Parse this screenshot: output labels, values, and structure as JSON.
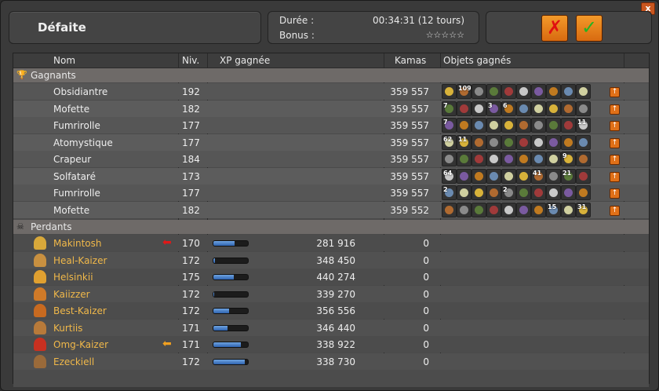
{
  "window": {
    "title": "Défaite",
    "close_label": "x"
  },
  "info": {
    "duration_label": "Durée :",
    "duration_value": "00:34:31 (12 tours)",
    "bonus_label": "Bonus :",
    "bonus_stars": "☆☆☆☆☆"
  },
  "actions": {
    "refuse_symbol": "✗",
    "accept_symbol": "✓"
  },
  "columns": {
    "name": "Nom",
    "level": "Niv.",
    "xp": "XP gagnée",
    "kamas": "Kamas",
    "items": "Objets gagnés"
  },
  "colors": {
    "accent": "#e07018",
    "xp_bar": "#3d7bd0",
    "loser_name": "#f0b84a"
  },
  "winners": {
    "label": "Gagnants",
    "icon": "trophy-icon",
    "rows": [
      {
        "name": "Obsidiantre",
        "level": "192",
        "kamas": "359 557",
        "item_count": 10,
        "qty": {
          "1": "109"
        }
      },
      {
        "name": "Mofette",
        "level": "182",
        "kamas": "359 557",
        "item_count": 10,
        "qty": {
          "0": "7",
          "3": "3",
          "4": "6"
        }
      },
      {
        "name": "Fumrirolle",
        "level": "177",
        "kamas": "359 557",
        "item_count": 10,
        "qty": {
          "0": "7",
          "9": "11"
        }
      },
      {
        "name": "Atomystique",
        "level": "177",
        "kamas": "359 557",
        "item_count": 10,
        "qty": {
          "0": "62",
          "1": "11"
        }
      },
      {
        "name": "Crapeur",
        "level": "184",
        "kamas": "359 557",
        "item_count": 10,
        "qty": {
          "8": "9"
        }
      },
      {
        "name": "Solfataré",
        "level": "173",
        "kamas": "359 557",
        "item_count": 10,
        "qty": {
          "0": "64",
          "6": "41",
          "8": "21"
        }
      },
      {
        "name": "Fumrirolle",
        "level": "177",
        "kamas": "359 557",
        "item_count": 10,
        "qty": {
          "0": "2",
          "4": "2"
        }
      },
      {
        "name": "Mofette",
        "level": "182",
        "kamas": "359 552",
        "item_count": 10,
        "qty": {
          "7": "15",
          "9": "31"
        }
      }
    ]
  },
  "losers": {
    "label": "Perdants",
    "icon": "skull-icon",
    "rows": [
      {
        "name": "Makintosh",
        "level": "170",
        "xp": "281 916",
        "xp_fill": 0.62,
        "kamas": "0",
        "arrow": "red"
      },
      {
        "name": "Heal-Kaizer",
        "level": "172",
        "xp": "348 450",
        "xp_fill": 0.05,
        "kamas": "0"
      },
      {
        "name": "Helsinkii",
        "level": "175",
        "xp": "440 274",
        "xp_fill": 0.58,
        "kamas": "0"
      },
      {
        "name": "Kaiizzer",
        "level": "172",
        "xp": "339 270",
        "xp_fill": 0.02,
        "kamas": "0"
      },
      {
        "name": "Best-Kaizer",
        "level": "172",
        "xp": "356 556",
        "xp_fill": 0.45,
        "kamas": "0"
      },
      {
        "name": "Kurtiis",
        "level": "171",
        "xp": "346 440",
        "xp_fill": 0.4,
        "kamas": "0"
      },
      {
        "name": "Omg-Kaizer",
        "level": "171",
        "xp": "338 922",
        "xp_fill": 0.8,
        "kamas": "0",
        "arrow": "orange"
      },
      {
        "name": "Ezeckiell",
        "level": "172",
        "xp": "338 730",
        "xp_fill": 0.9,
        "kamas": "0"
      }
    ]
  }
}
